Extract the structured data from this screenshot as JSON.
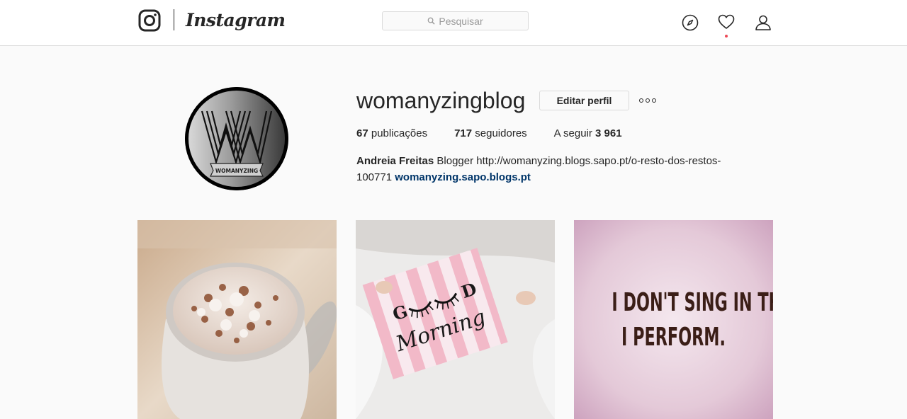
{
  "nav": {
    "logo_text": "Instagram",
    "search_placeholder": "Pesquisar",
    "icons": [
      "instagram-glyph-icon",
      "search-icon",
      "compass-icon",
      "heart-icon",
      "user-icon"
    ],
    "notification_dot_color": "#ed4956"
  },
  "profile": {
    "username": "womanyzingblog",
    "edit_label": "Editar perfil",
    "more_icon": "more-options-icon",
    "stats": {
      "posts_count": "67",
      "posts_label": "publicações",
      "followers_count": "717",
      "followers_label": "seguidores",
      "following_label": "A seguir",
      "following_count": "3 961"
    },
    "bio": {
      "full_name": "Andreia Freitas",
      "text": " Blogger http://womanyzing.blogs.sapo.pt/o-resto-dos-restos-100771 ",
      "link": "womanyzing.sapo.blogs.pt",
      "link_color": "#003569"
    },
    "avatar_logo_text": "WOMANYZING"
  },
  "posts": [
    {
      "subject": "hot-chocolate-mug-photo"
    },
    {
      "subject": "good-morning-pillow-photo",
      "pillow_text_top": "G  D",
      "pillow_text_script": "Morning"
    },
    {
      "subject": "quote-image",
      "line1": "I DON'T SING IN THE CAR.",
      "line2": "I PERFORM."
    }
  ]
}
